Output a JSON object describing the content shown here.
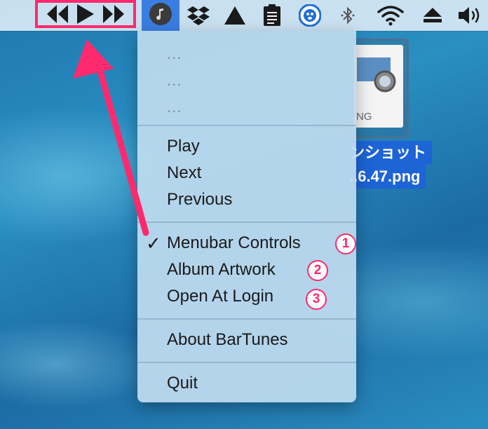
{
  "menubar": {
    "icons": [
      "rewind-icon",
      "play-icon",
      "fast-forward-icon",
      "music-note-icon",
      "dropbox-icon",
      "triangle-app-icon",
      "clipboard-icon",
      "penguin-icon",
      "bluetooth-icon",
      "wifi-icon",
      "eject-icon",
      "volume-icon"
    ]
  },
  "menu": {
    "placeholders": [
      "...",
      "...",
      "..."
    ],
    "playback": [
      "Play",
      "Next",
      "Previous"
    ],
    "options": [
      {
        "label": "Menubar Controls",
        "checked": true,
        "badge": "1"
      },
      {
        "label": "Album Artwork",
        "checked": false,
        "badge": "2"
      },
      {
        "label": "Open At Login",
        "checked": false,
        "badge": "3"
      }
    ],
    "about": "About BarTunes",
    "quit": "Quit",
    "checkmark": "✓"
  },
  "desktop": {
    "file_ext": "NG",
    "file_name_line1": "ンショット",
    "file_name_line2": "..6.47.png"
  },
  "colors": {
    "highlight_pink": "#ff2a6d",
    "menubar_selected": "#3a7de0",
    "selection_blue": "#1d64d6"
  }
}
